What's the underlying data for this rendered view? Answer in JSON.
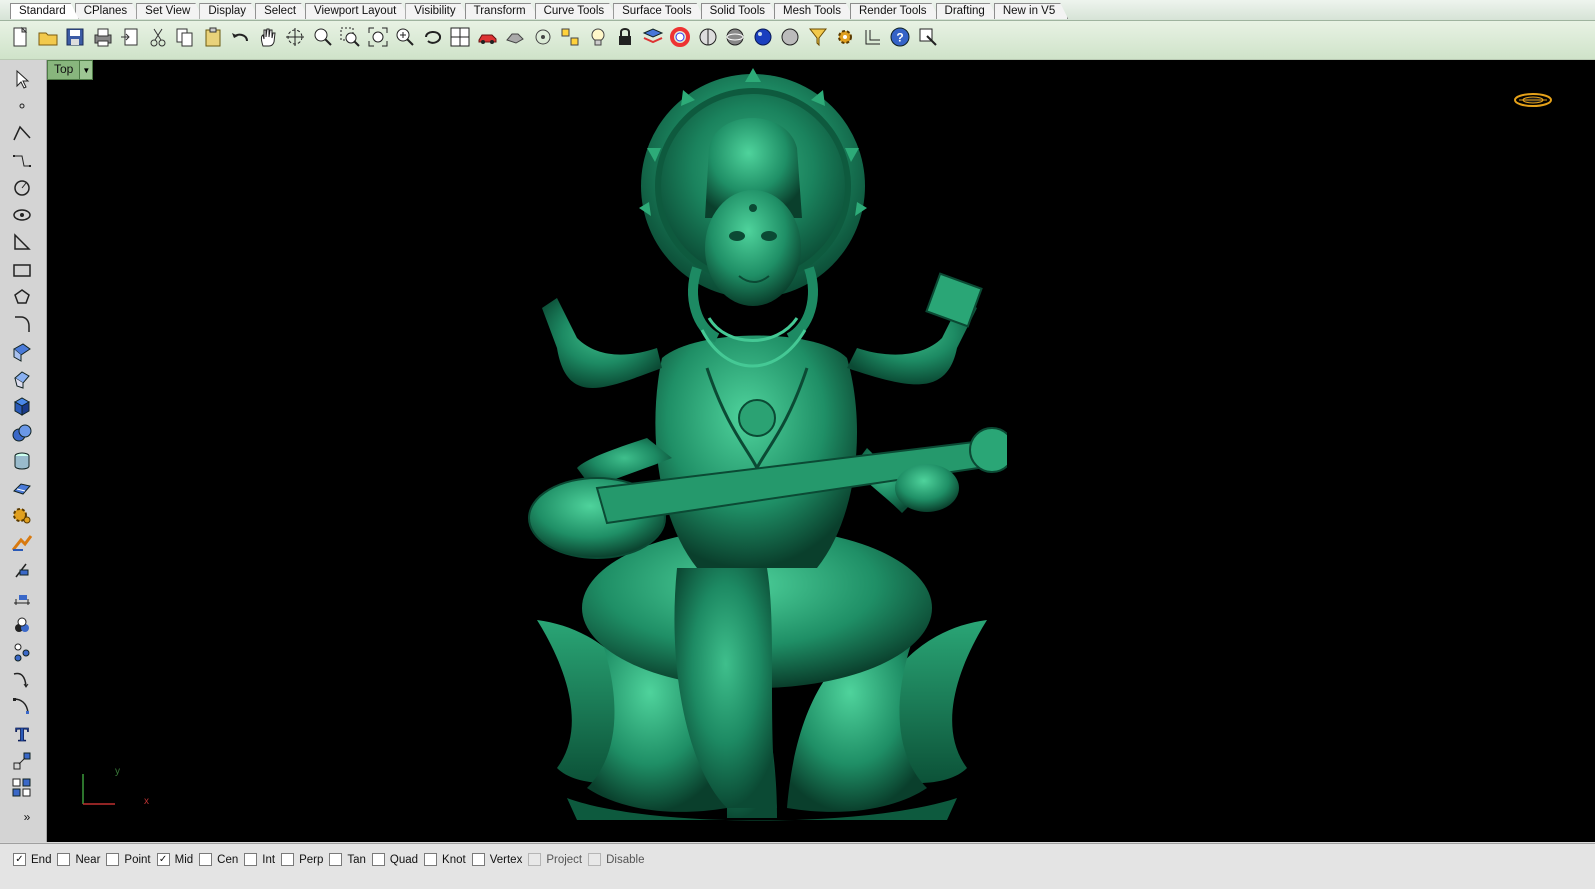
{
  "tabs": [
    "Standard",
    "CPlanes",
    "Set View",
    "Display",
    "Select",
    "Viewport Layout",
    "Visibility",
    "Transform",
    "Curve Tools",
    "Surface Tools",
    "Solid Tools",
    "Mesh Tools",
    "Render Tools",
    "Drafting",
    "New in V5"
  ],
  "active_tab": "Standard",
  "toolbar": {
    "icons": [
      "new-file-icon",
      "open-folder-icon",
      "save-icon",
      "print-icon",
      "import-icon",
      "cut-icon",
      "copy-icon",
      "paste-icon",
      "undo-icon",
      "pan-hand-icon",
      "rotate-view-icon",
      "zoom-dynamic-icon",
      "zoom-window-icon",
      "zoom-extents-icon",
      "zoom-selected-icon",
      "undo-view-icon",
      "four-viewports-icon",
      "car-model-icon",
      "hide-icon",
      "visibility-circle-icon",
      "snap-grid-icon",
      "light-bulb-icon",
      "lock-icon",
      "layer-icon",
      "color-wheel-icon",
      "wireframe-sphere-icon",
      "shaded-sphere-icon",
      "rendered-sphere-icon",
      "ghosted-sphere-icon",
      "select-filter-icon",
      "settings-gear-icon",
      "grid-snap-icon",
      "help-icon",
      "properties-icon"
    ]
  },
  "left_toolbar": {
    "icons": [
      "select-arrow-icon",
      "point-icon",
      "polyline-icon",
      "curve-icon",
      "circle-icon",
      "ellipse-icon",
      "arc-icon",
      "rectangle-icon",
      "polygon-icon",
      "fillet-icon",
      "surface-icon",
      "extrude-icon",
      "box-solid-icon",
      "boolean-icon",
      "cylinder-icon",
      "plane-icon",
      "mesh-gear-icon",
      "render-icon",
      "trim-icon",
      "dimension-icon",
      "analysis-icon",
      "group-icon",
      "curve-blend-icon",
      "rebuild-icon",
      "text-icon",
      "transform-icon",
      "array-icon"
    ],
    "more_label": "»"
  },
  "viewport": {
    "name": "Top",
    "axis_x_label": "x",
    "axis_y_label": "y",
    "background": "#000000",
    "model_color": "#1d8a63",
    "model": "saraswati-statue-on-lotus"
  },
  "osnap": [
    {
      "label": "End",
      "checked": true,
      "enabled": true
    },
    {
      "label": "Near",
      "checked": false,
      "enabled": true
    },
    {
      "label": "Point",
      "checked": false,
      "enabled": true
    },
    {
      "label": "Mid",
      "checked": true,
      "enabled": true
    },
    {
      "label": "Cen",
      "checked": false,
      "enabled": true
    },
    {
      "label": "Int",
      "checked": false,
      "enabled": true
    },
    {
      "label": "Perp",
      "checked": false,
      "enabled": true
    },
    {
      "label": "Tan",
      "checked": false,
      "enabled": true
    },
    {
      "label": "Quad",
      "checked": false,
      "enabled": true
    },
    {
      "label": "Knot",
      "checked": false,
      "enabled": true
    },
    {
      "label": "Vertex",
      "checked": false,
      "enabled": true
    },
    {
      "label": "Project",
      "checked": false,
      "enabled": false
    },
    {
      "label": "Disable",
      "checked": false,
      "enabled": false
    }
  ]
}
